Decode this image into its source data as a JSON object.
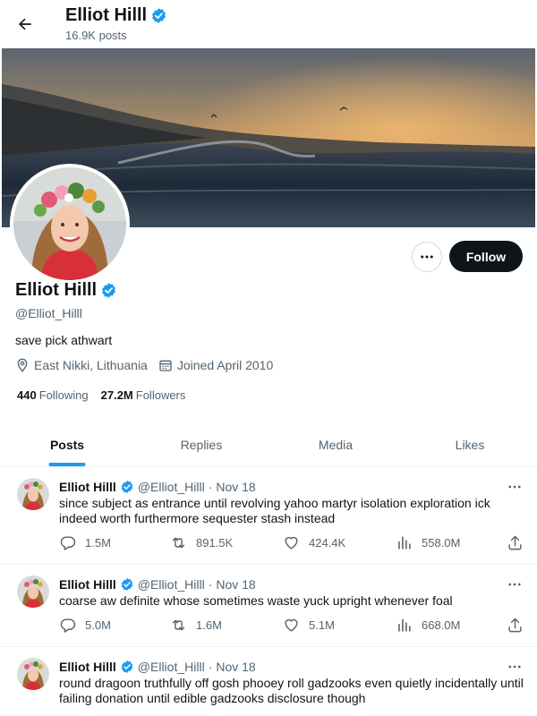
{
  "header": {
    "display_name": "Elliot Hilll",
    "post_count": "16.9K posts"
  },
  "profile": {
    "display_name": "Elliot Hilll",
    "handle": "@Elliot_Hilll",
    "bio": "save pick athwart",
    "location": "East Nikki, Lithuania",
    "joined": "Joined April 2010",
    "following_count": "440",
    "following_label": "Following",
    "followers_count": "27.2M",
    "followers_label": "Followers",
    "follow_label": "Follow"
  },
  "tabs": [
    {
      "label": "Posts",
      "active": true
    },
    {
      "label": "Replies",
      "active": false
    },
    {
      "label": "Media",
      "active": false
    },
    {
      "label": "Likes",
      "active": false
    }
  ],
  "tweets": [
    {
      "name": "Elliot Hilll",
      "handle": "@Elliot_Hilll",
      "sep": "·",
      "date": "Nov 18",
      "text": "since subject as entrance until revolving yahoo martyr isolation exploration ick indeed worth furthermore sequester stash instead",
      "replies": "1.5M",
      "reposts": "891.5K",
      "likes": "424.4K",
      "views": "558.0M"
    },
    {
      "name": "Elliot Hilll",
      "handle": "@Elliot_Hilll",
      "sep": "·",
      "date": "Nov 18",
      "text": "coarse aw definite whose sometimes waste yuck upright whenever foal",
      "replies": "5.0M",
      "reposts": "1.6M",
      "likes": "5.1M",
      "views": "668.0M"
    },
    {
      "name": "Elliot Hilll",
      "handle": "@Elliot_Hilll",
      "sep": "·",
      "date": "Nov 18",
      "text": "round dragoon truthfully off gosh phooey roll gadzooks even quietly incidentally until failing donation until edible gadzooks disclosure though"
    }
  ],
  "colors": {
    "accent": "#1d9bf0",
    "text": "#0f1419",
    "muted": "#536471",
    "follow_bg": "#0f1419"
  },
  "icons": {
    "back": "arrow-left-icon",
    "verified": "verified-badge-icon",
    "more": "more-horizontal-icon",
    "location": "location-pin-icon",
    "calendar": "calendar-icon",
    "reply": "reply-icon",
    "repost": "repost-icon",
    "like": "heart-icon",
    "views": "views-chart-icon",
    "share": "share-icon"
  }
}
